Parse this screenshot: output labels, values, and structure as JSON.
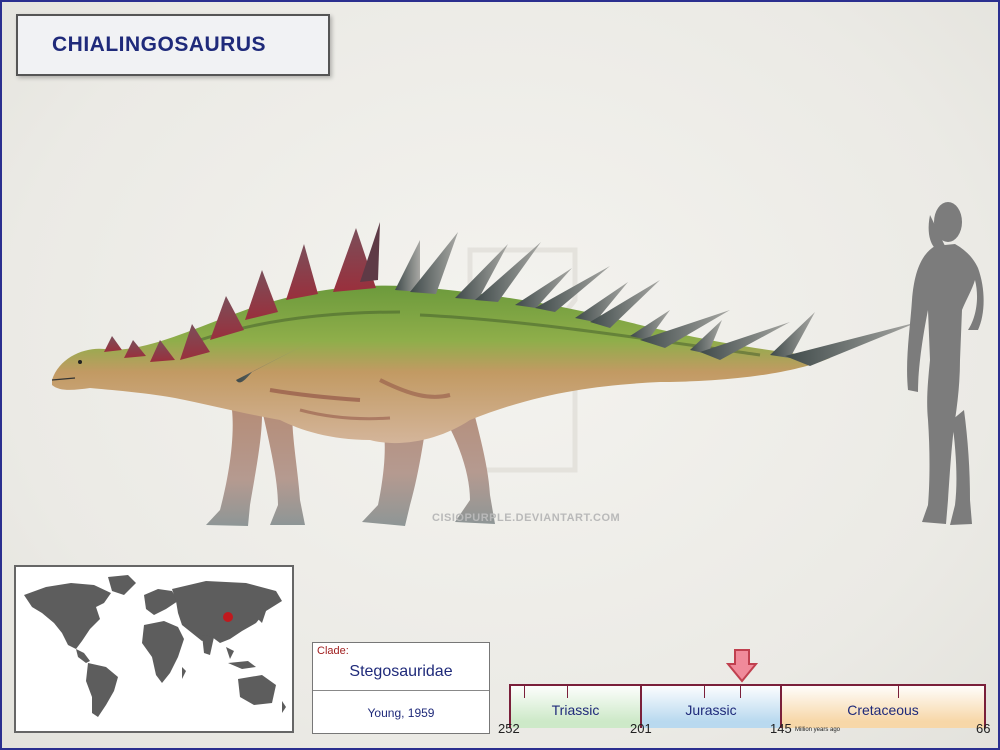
{
  "title": "CHIALINGOSAURUS",
  "watermark": "CISIOPURPLE.DEVIANTART.COM",
  "clade": {
    "label": "Clade:",
    "name": "Stegosauridae",
    "author": "Young, 1959"
  },
  "timeline": {
    "periods": [
      {
        "name": "Triassic",
        "color": "#cde9c8"
      },
      {
        "name": "Jurassic",
        "color": "#b9d9ef"
      },
      {
        "name": "Cretaceous",
        "color": "#f7d7a8"
      }
    ],
    "ticks": [
      "252",
      "201",
      "145",
      "66"
    ],
    "unit": "Million years ago",
    "marker_color": "#f08a9a"
  },
  "map": {
    "land_color": "#5d5d5d",
    "location_dot_color": "#c0191e"
  },
  "icons": {
    "dinosaur": "stegosaur-illustration",
    "human": "human-silhouette",
    "map": "world-map",
    "marker": "down-arrow-icon"
  }
}
